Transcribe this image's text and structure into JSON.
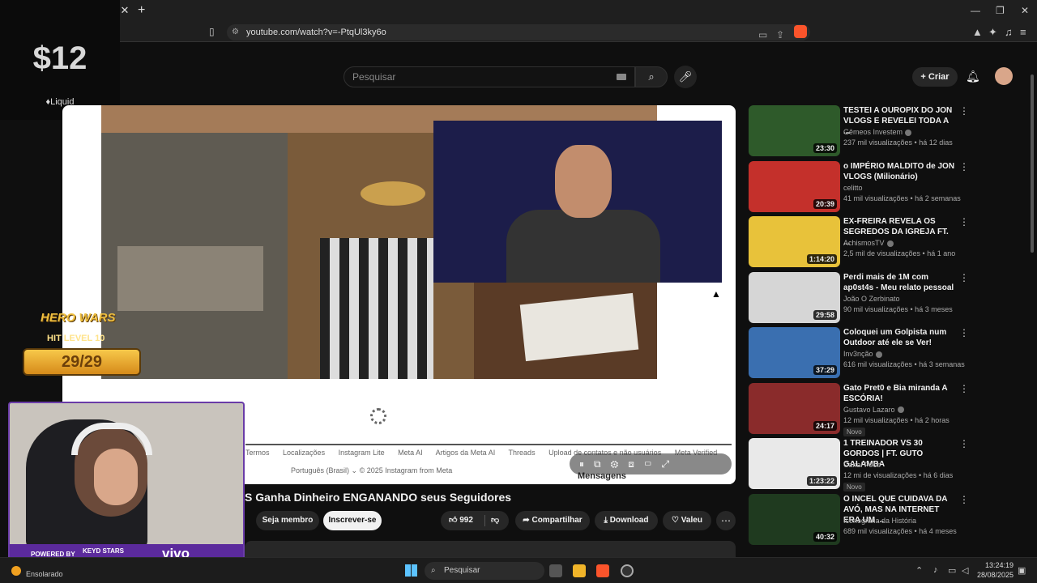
{
  "browser": {
    "url": "youtube.com/watch?v=-PtqUl3ky6o"
  },
  "overlay": {
    "price": "$12",
    "brand": "Liquid"
  },
  "youtube": {
    "search_placeholder": "Pesquisar",
    "create_label": "Criar"
  },
  "player": {
    "footer_links": [
      "Termos",
      "Localizações",
      "Instagram Lite",
      "Meta AI",
      "Artigos da Meta AI",
      "Threads",
      "Upload de contatos e não usuários",
      "Meta Verified"
    ],
    "footer_lang": "Português (Brasil)  ⌄    © 2025 Instagram from Meta",
    "messages": "Mensagens"
  },
  "video": {
    "title": "S Ganha Dinheiro ENGANANDO seus Seguidores",
    "join_label": "Seja membro",
    "subscribe_label": "Inscrever-se",
    "likes": "992",
    "share_label": "Compartilhar",
    "download_label": "Download",
    "thanks_label": "Valeu"
  },
  "hero_wars": {
    "title": "HERO WARS",
    "level": "HIT LEVEL 10",
    "count": "29/29"
  },
  "webcam": {
    "powered": "POWERED BY",
    "sponsor": "KEYD STARS",
    "brand": "vivo"
  },
  "recommendations": [
    {
      "title": "TESTEI A OUROPIX DO JON VLOGS E REVELEI TODA A ...",
      "channel": "Gêmeos Investem",
      "meta": "237 mil visualizações • há 12 dias",
      "duration": "23:30",
      "color": "#2e5a2a",
      "verified": true
    },
    {
      "title": "o IMPÉRIO MALDITO de JON VLOGS (Milionário)",
      "channel": "celitto",
      "meta": "41 mil visualizações • há 2 semanas",
      "duration": "20:39",
      "color": "#c4302b",
      "verified": false
    },
    {
      "title": "EX-FREIRA REVELA OS SEGREDOS DA IGREJA FT. ...",
      "channel": "AchismosTV",
      "meta": "2,5 mil de visualizações • há 1 ano",
      "duration": "1:14:20",
      "color": "#e8c23a",
      "verified": true
    },
    {
      "title": "Perdi mais de 1M com ap0st4s - Meu relato pessoal",
      "channel": "João O Zerbinato",
      "meta": "90 mil visualizações • há 3 meses",
      "duration": "29:58",
      "color": "#d6d6d6",
      "verified": false
    },
    {
      "title": "Coloquei um Golpista num Outdoor até ele se Ver!",
      "channel": "Inv3nção",
      "meta": "616 mil visualizações • há 3 semanas",
      "duration": "37:29",
      "color": "#3a6fb0",
      "verified": true
    },
    {
      "title": "Gato Pret0 e Bia miranda A ESCÓRIA!",
      "channel": "Gustavo Lazaro",
      "meta": "12 mil visualizações • há 2 horas",
      "duration": "24:17",
      "color": "#8a2b2b",
      "verified": true,
      "badge": "Novo"
    },
    {
      "title": "1 TREINADOR VS 30 GORDOS | FT. GUTO GALAMBA",
      "channel": "Canal Foco",
      "meta": "12 mi de visualizações • há 6 dias",
      "duration": "1:23:22",
      "color": "#e9e9e9",
      "verified": false,
      "badge": "Novo"
    },
    {
      "title": "O INCEL QUE CUIDAVA DA AVÓ, MAS NA INTERNET ERA UM ...",
      "channel": "Iconografia da História",
      "meta": "689 mil visualizações • há 4 meses",
      "duration": "40:32",
      "color": "#1f3a1f",
      "verified": false
    }
  ],
  "taskbar": {
    "weather": "Ensolarado",
    "search": "Pesquisar",
    "time": "13:24:19",
    "date": "28/08/2025"
  }
}
